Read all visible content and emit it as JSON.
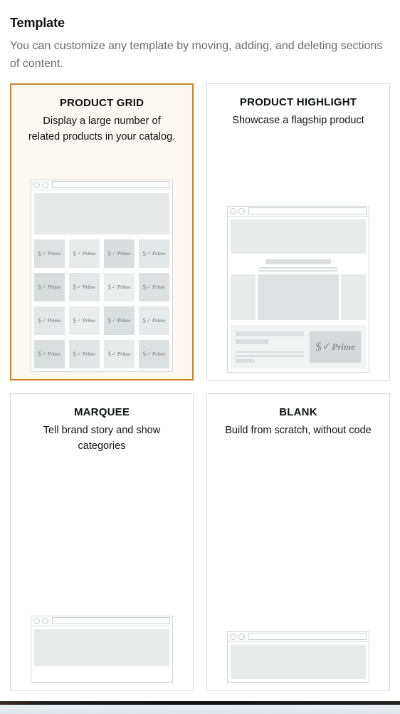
{
  "header": {
    "title": "Template",
    "subtitle": "You can customize any template by moving, adding, and deleting sections of content."
  },
  "colors": {
    "selected_border": "#c8832b",
    "selected_background": "#fdf8f2",
    "card_border": "#d5d9d9",
    "title_text": "#0f1111",
    "subtitle_text": "#6b6b6b",
    "placeholder_gray": "#e9ebeb"
  },
  "prime_mark": {
    "dollar": "$",
    "check": "✓",
    "word": "Prime"
  },
  "templates": [
    {
      "id": "product-grid",
      "title": "PRODUCT GRID",
      "description": "Display a large number of related products in your catalog.",
      "selected": true,
      "preview": "product-grid-preview"
    },
    {
      "id": "product-highlight",
      "title": "PRODUCT HIGHLIGHT",
      "description": "Showcase a flagship product",
      "selected": false,
      "preview": "product-highlight-preview"
    },
    {
      "id": "marquee",
      "title": "MARQUEE",
      "description": "Tell brand story and show categories",
      "selected": false,
      "preview": "marquee-preview"
    },
    {
      "id": "blank",
      "title": "BLANK",
      "description": "Build from scratch, without code",
      "selected": false,
      "preview": "blank-preview"
    }
  ],
  "product_grid_preview": {
    "rows": 4,
    "columns": 4,
    "tile_shades": [
      [
        "#dfe2e3",
        "#e9ebeb",
        "#d9dddf",
        "#e4e7e8"
      ],
      [
        "#d7dcdd",
        "#e4e7e8",
        "#eceeee",
        "#dde1e2"
      ],
      [
        "#e4e7e8",
        "#eceeee",
        "#dadfe0",
        "#e7eaea"
      ],
      [
        "#d9dedf",
        "#e2e5e6",
        "#e9ebeb",
        "#dce0e1"
      ]
    ]
  }
}
